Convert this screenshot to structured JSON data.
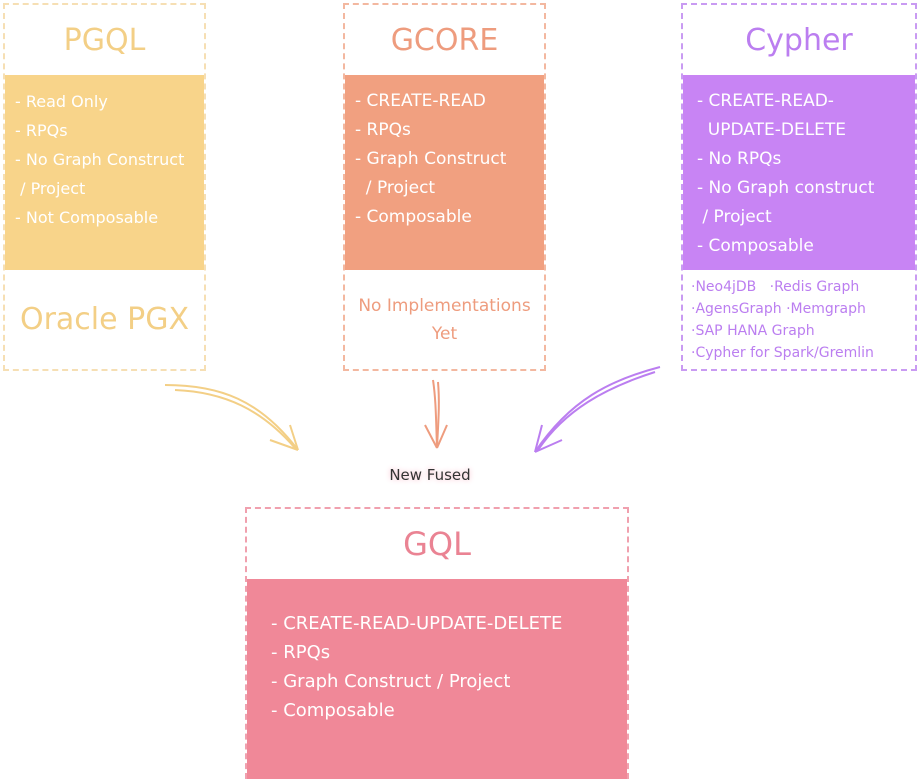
{
  "pgql": {
    "title": "PGQL",
    "features": "- Read Only\n- RPQs\n- No Graph Construct\n / Project\n- Not Composable",
    "implementations": [
      "Oracle PGX"
    ],
    "color": "#f8d48a"
  },
  "gcore": {
    "title": "GCORE",
    "features": "- CREATE-READ\n- RPQs\n- Graph Construct\n  / Project\n- Composable",
    "implementations": [
      "No Implementations",
      "Yet"
    ],
    "color": "#f1a080"
  },
  "cypher": {
    "title": "Cypher",
    "features": "- CREATE-READ-\n  UPDATE-DELETE\n- No RPQs\n- No Graph construct\n / Project\n- Composable",
    "implementations": [
      "·Neo4jDB   ·Redis Graph",
      "·AgensGraph ·Memgraph",
      "·SAP HANA Graph",
      "·Cypher for Spark/Gremlin"
    ],
    "color": "#c884f4"
  },
  "fused_label": "New Fused",
  "gql": {
    "title": "GQL",
    "features": "- CREATE-READ-UPDATE-DELETE\n- RPQs\n- Graph Construct / Project\n- Composable",
    "color": "#f08898"
  }
}
